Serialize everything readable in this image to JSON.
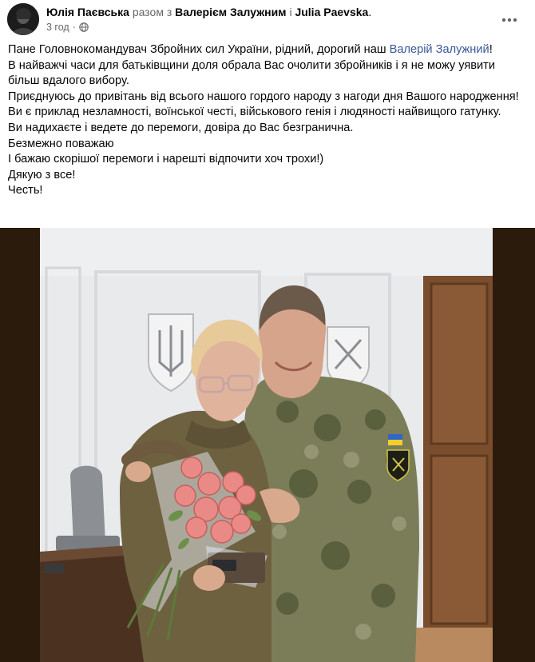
{
  "post": {
    "author": "Юлія Паєвська",
    "connector": "разом з",
    "tagged_1": "Валерієм Залужним",
    "connector_and": "і",
    "tagged_2": "Julia Paevska",
    "period": ".",
    "time": "3 год",
    "separator": "·",
    "privacy_icon": "globe-icon",
    "more_icon": "more-dots-icon",
    "lines": [
      {
        "before": "Пане Головнокомандувач Збройних сил України, рідний, дорогий наш ",
        "mention": "Валерій Залужний",
        "after": "!"
      },
      {
        "text": "В найважчі часи для батьківщини доля обрала Вас очолити збройників і я не можу уявити більш вдалого вибору."
      },
      {
        "text": "Приєднуюсь до привітань від всього нашого гордого народу з нагоди дня Вашого народження!"
      },
      {
        "text": "Ви є приклад незламності, воїнської честі, військового генія і людяності найвищого гатунку."
      },
      {
        "text": "Ви надихаєте і ведете до перемоги, довіра до Вас безгранична."
      },
      {
        "text": "Безмежно поважаю"
      },
      {
        "text": "І бажаю скорішої перемоги і нарешті відпочити хоч трохи!)"
      },
      {
        "text": "Дякую з все!"
      },
      {
        "text": "Честь!"
      }
    ]
  },
  "colors": {
    "link": "#385898",
    "secondary_text": "#65676b",
    "photo_frame": "#2a1a0c"
  }
}
